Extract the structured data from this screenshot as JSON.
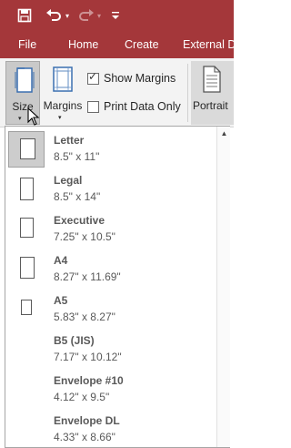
{
  "quick_access": {
    "icons": [
      "save-icon",
      "undo-icon",
      "redo-icon",
      "customize-toolbar-icon"
    ],
    "undo_dropdown_glyph": "▾",
    "redo_dropdown_glyph": "▾",
    "customize_glyph": "▾"
  },
  "tabs": [
    {
      "label": "File"
    },
    {
      "label": "Home"
    },
    {
      "label": "Create"
    },
    {
      "label": "External Da"
    }
  ],
  "ribbon": {
    "size_label": "Size",
    "size_arrow": "▾",
    "margins_label": "Margins",
    "margins_arrow": "▾",
    "show_margins": {
      "label": "Show Margins",
      "checked": true,
      "tick": "✓"
    },
    "print_data_only": {
      "label": "Print Data Only",
      "checked": false
    },
    "portrait_label": "Portrait"
  },
  "size_gallery": {
    "scroll_up_glyph": "▲",
    "items": [
      {
        "name": "Letter",
        "dims": "8.5\" x 11\"",
        "selected": true
      },
      {
        "name": "Legal",
        "dims": "8.5\" x 14\"",
        "selected": false
      },
      {
        "name": "Executive",
        "dims": "7.25\" x 10.5\"",
        "selected": false
      },
      {
        "name": "A4",
        "dims": "8.27\" x 11.69\"",
        "selected": false
      },
      {
        "name": "A5",
        "dims": "5.83\" x 8.27\"",
        "selected": false
      },
      {
        "name": "B5 (JIS)",
        "dims": "7.17\" x 10.12\"",
        "selected": false
      },
      {
        "name": "Envelope #10",
        "dims": "4.12\" x 9.5\"",
        "selected": false
      },
      {
        "name": "Envelope DL",
        "dims": "4.33\" x 8.66\"",
        "selected": false
      }
    ]
  },
  "colors": {
    "title_bar": "#a4373a",
    "ribbon_background": "#f3f3f3",
    "selected_button": "#c9c9c9",
    "gallery_text": "#595959"
  }
}
